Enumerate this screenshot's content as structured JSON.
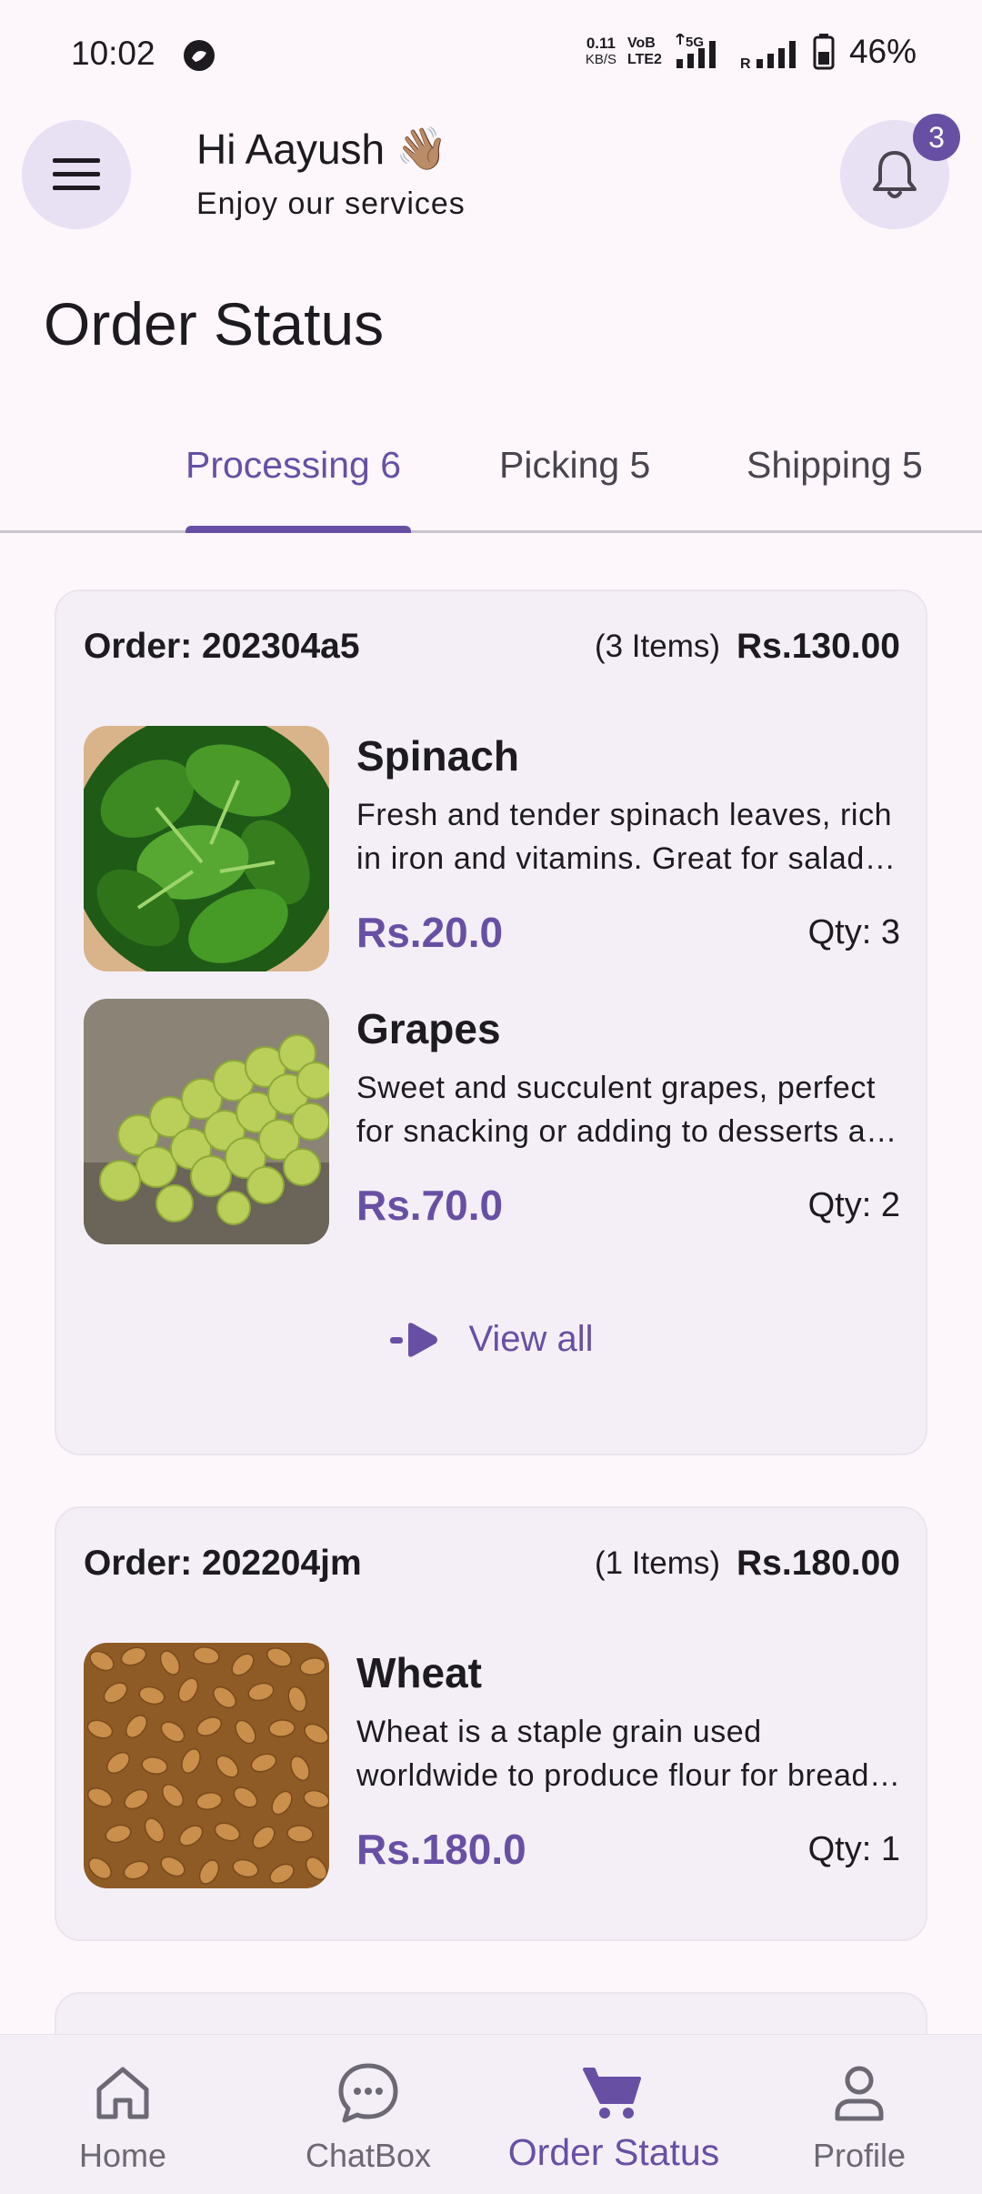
{
  "status_bar": {
    "time": "10:02",
    "net_speed_value": "0.11",
    "net_speed_unit": "KB/S",
    "volte_top": "VoB",
    "volte_bottom": "LTE2",
    "network_type": "5G",
    "roaming": "R",
    "battery": "46%"
  },
  "header": {
    "greeting": "Hi Aayush",
    "greeting_emoji": "👋🏽",
    "subtitle": "Enjoy our services",
    "notification_count": "3",
    "menu_icon": "hamburger-menu-icon",
    "bell_icon": "bell-icon"
  },
  "page_title": "Order Status",
  "tabs": [
    {
      "label": "Processing 6",
      "active": true
    },
    {
      "label": "Picking 5",
      "active": false
    },
    {
      "label": "Shipping 5",
      "active": false
    }
  ],
  "orders": [
    {
      "id_label": "Order: 202304a5",
      "count_label": "(3 Items)",
      "total": "Rs.130.00",
      "products": [
        {
          "name": "Spinach",
          "description": "Fresh and tender spinach leaves, rich in iron and vitamins. Great for salads, smoothies and cooking.",
          "price": "Rs.20.0",
          "qty": "Qty: 3"
        },
        {
          "name": "Grapes",
          "description": "Sweet and succulent grapes, perfect for snacking or adding to desserts and fruit salads.",
          "price": "Rs.70.0",
          "qty": "Qty: 2"
        }
      ],
      "view_all_label": "View all"
    },
    {
      "id_label": "Order: 202204jm",
      "count_label": "(1 Items)",
      "total": "Rs.180.00",
      "products": [
        {
          "name": "Wheat",
          "description": "Wheat is a staple grain used worldwide to produce flour for bread, pasta and baked goods.",
          "price": "Rs.180.0",
          "qty": "Qty: 1"
        }
      ]
    }
  ],
  "bottom_nav": [
    {
      "label": "Home",
      "icon": "home-icon",
      "active": false
    },
    {
      "label": "ChatBox",
      "icon": "chat-bubble-icon",
      "active": false
    },
    {
      "label": "Order Status",
      "icon": "shopping-cart-icon",
      "active": true
    },
    {
      "label": "Profile",
      "icon": "person-icon",
      "active": false
    }
  ],
  "colors": {
    "primary": "#6750a4",
    "background": "#fdf7fc",
    "card": "#f4eff6",
    "icon_button_bg": "#e8e0f3"
  }
}
